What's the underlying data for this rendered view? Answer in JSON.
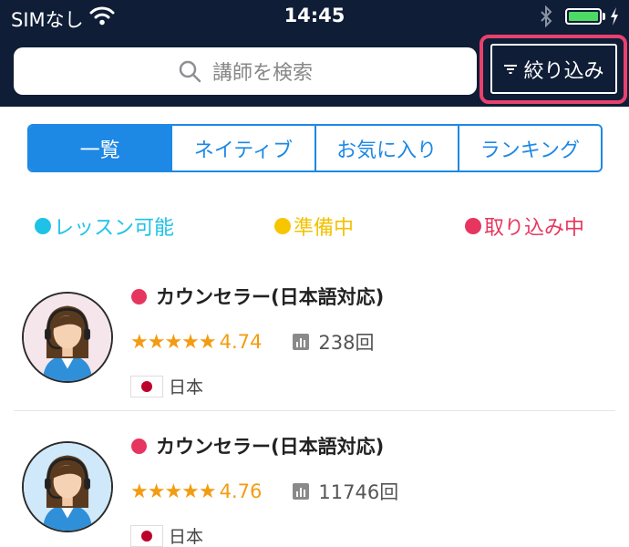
{
  "status_bar": {
    "carrier": "SIMなし",
    "time": "14:45"
  },
  "search": {
    "placeholder": "講師を検索"
  },
  "filter": {
    "label": "絞り込み"
  },
  "tabs": [
    {
      "label": "一覧",
      "active": true
    },
    {
      "label": "ネイティブ",
      "active": false
    },
    {
      "label": "お気に入り",
      "active": false
    },
    {
      "label": "ランキング",
      "active": false
    }
  ],
  "legend": {
    "available": "レッスン可能",
    "preparing": "準備中",
    "busy": "取り込み中"
  },
  "tutors": [
    {
      "name": "カウンセラー(日本語対応)",
      "stars": "★★★★★",
      "rating": "4.74",
      "lesson_count": "238回",
      "country": "日本"
    },
    {
      "name": "カウンセラー(日本語対応)",
      "stars": "★★★★★",
      "rating": "4.76",
      "lesson_count": "11746回",
      "country": "日本"
    }
  ],
  "colors": {
    "header_bg": "#0f1d36",
    "accent": "#1e88e5",
    "available": "#1ec2e6",
    "preparing": "#f7c600",
    "busy": "#e6365f",
    "rating": "#f39c12"
  }
}
